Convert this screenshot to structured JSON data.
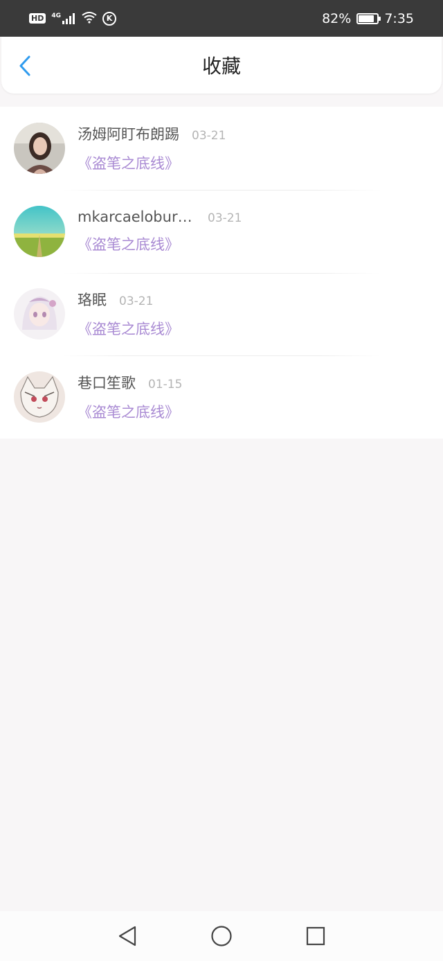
{
  "status_bar": {
    "hd": "HD",
    "network": "4G",
    "k_icon": "K",
    "battery_percent": "82%",
    "battery_level": 0.82,
    "time": "7:35"
  },
  "header": {
    "title": "收藏",
    "back_icon": "chevron-left-icon",
    "accent_color": "#2f9bee"
  },
  "favorites": [
    {
      "name": "汤姆阿盯布朗踢",
      "date": "03-21",
      "book": "《盗笔之底线》",
      "avatar": "portrait-girl"
    },
    {
      "name": "mkarcaeloburl...",
      "date": "03-21",
      "book": "《盗笔之底线》",
      "avatar": "landscape-field"
    },
    {
      "name": "珞眠",
      "date": "03-21",
      "book": "《盗笔之底线》",
      "avatar": "anime-girl-purple"
    },
    {
      "name": "巷口笙歌",
      "date": "01-15",
      "book": "《盗笔之底线》",
      "avatar": "anime-character-sketch"
    }
  ],
  "colors": {
    "book_title": "#a98ad3",
    "username": "#555555",
    "date": "#b4b4b4",
    "background": "#f8f6f7"
  },
  "nav": {
    "back": "triangle-back-icon",
    "home": "circle-home-icon",
    "recents": "square-recents-icon"
  }
}
